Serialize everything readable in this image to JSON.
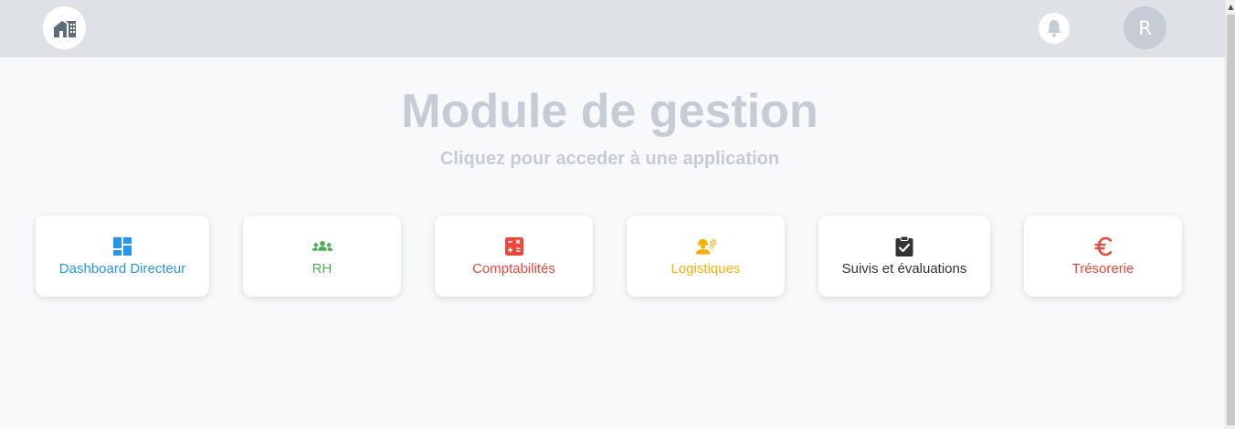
{
  "header": {
    "avatar_initial": "R",
    "logo_icon": "home-building-icon",
    "notification_icon": "bell-icon"
  },
  "main": {
    "title": "Module de gestion",
    "subtitle": "Cliquez pour acceder à une application"
  },
  "apps": [
    {
      "label": "Dashboard Directeur",
      "icon": "dashboard-icon",
      "color": "#2196f3"
    },
    {
      "label": "RH",
      "icon": "team-icon",
      "color": "#4caf50"
    },
    {
      "label": "Comptabilités",
      "icon": "calculator-icon",
      "color": "#f44336"
    },
    {
      "label": "Logistiques",
      "icon": "engineer-icon",
      "color": "#f6b000"
    },
    {
      "label": "Suivis et évaluations",
      "icon": "clipboard-check-icon",
      "color": "#333333"
    },
    {
      "label": "Trésorerie",
      "icon": "euro-icon",
      "color": "#f44336"
    }
  ],
  "colors": {
    "topbar": "#dee1e6",
    "background": "#f8f9fb",
    "heading": "#c5ccd6"
  }
}
